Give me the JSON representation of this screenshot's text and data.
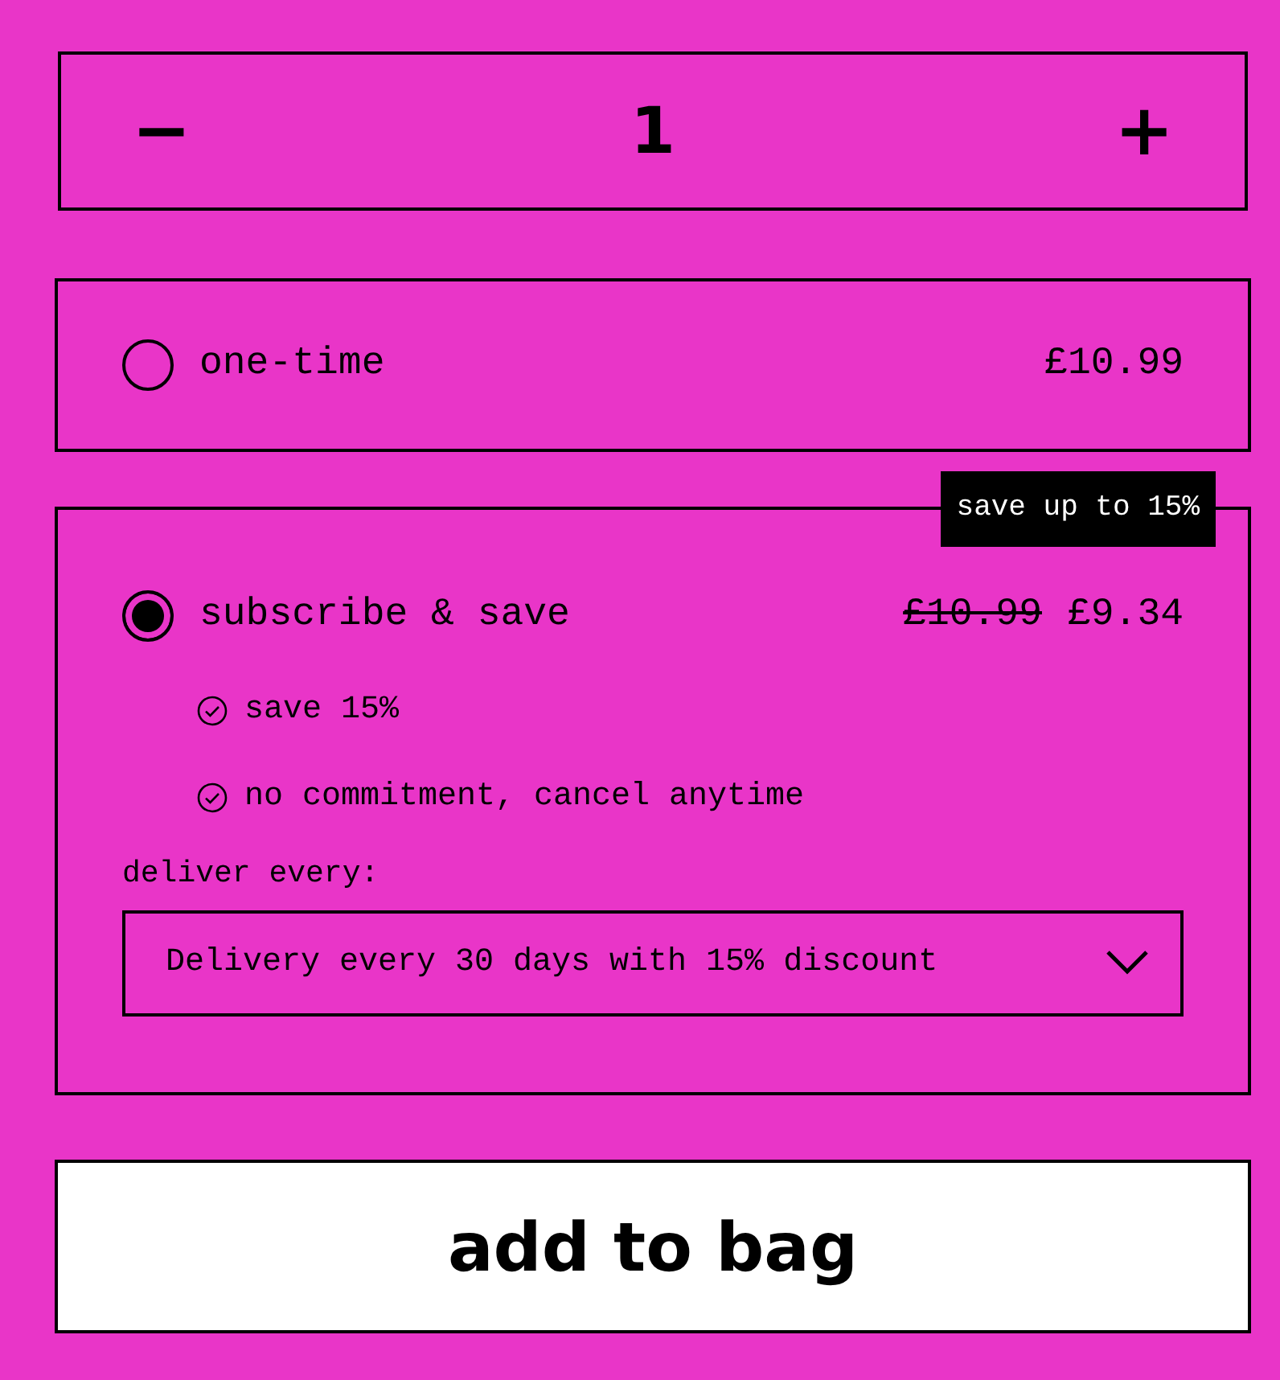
{
  "quantity": {
    "minus": "−",
    "value": "1",
    "plus": "+"
  },
  "options": [
    {
      "kind": "simple",
      "label": "one-time",
      "price": "£10.99",
      "selected": false
    },
    {
      "kind": "subscription",
      "label": "subscribe & save",
      "badge": "save up to 15%",
      "old_price": "£10.99",
      "price": "£9.34",
      "selected": true,
      "benefits": [
        "save 15%",
        "no commitment, cancel anytime"
      ],
      "delivery_label": "deliver every:",
      "delivery_value": "Delivery every 30 days with 15% discount"
    }
  ],
  "add_button": "add to bag"
}
